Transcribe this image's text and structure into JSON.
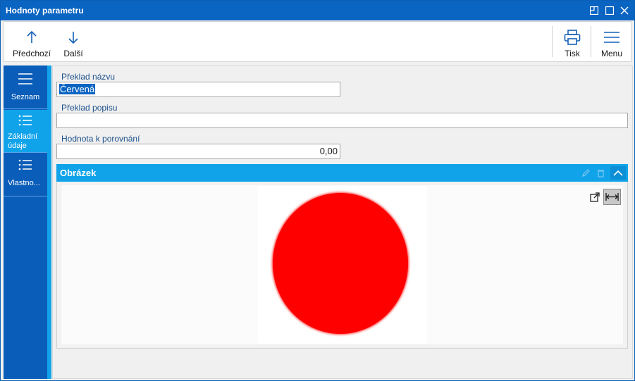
{
  "window": {
    "title": "Hodnoty parametru",
    "controls": [
      "restore-icon",
      "maximize-icon",
      "close-icon"
    ]
  },
  "toolbar": {
    "previous_label": "Předchozí",
    "next_label": "Další",
    "print_label": "Tisk",
    "menu_label": "Menu"
  },
  "sidebar": {
    "items": [
      {
        "label": "Seznam",
        "icon": "hamburger-icon",
        "active": false
      },
      {
        "label_line1": "Základní",
        "label_line2": "údaje",
        "icon": "list-icon",
        "active": true
      },
      {
        "label": "Vlastno...",
        "icon": "list-icon",
        "active": false
      }
    ]
  },
  "form": {
    "name_translation_label": "Překlad názvu",
    "name_translation_value": "Červená",
    "description_translation_label": "Překlad popisu",
    "description_translation_value": "",
    "compare_value_label": "Hodnota k porovnání",
    "compare_value": "0,00"
  },
  "image_section": {
    "title": "Obrázek",
    "image_content": "red circle",
    "tools": [
      "open-external-icon",
      "fit-width-icon"
    ]
  },
  "colors": {
    "title_bar": "#0a64c2",
    "sidebar": "#0a5db8",
    "accent": "#11a3ea",
    "circle": "#ff0000",
    "label_text": "#1b4f8a"
  }
}
